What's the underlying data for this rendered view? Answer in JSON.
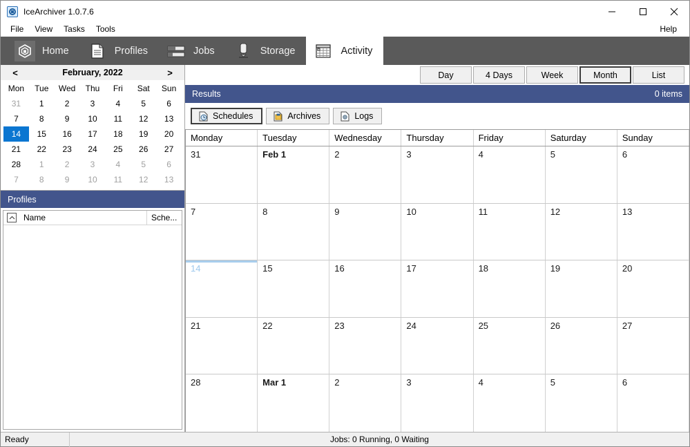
{
  "window": {
    "title": "IceArchiver 1.0.7.6",
    "app_icon": "app-hexagon-icon",
    "minimize_label": "minimize-icon",
    "maximize_label": "maximize-icon",
    "close_label": "close-icon"
  },
  "menubar": {
    "items": [
      "File",
      "View",
      "Tasks",
      "Tools"
    ],
    "help": "Help"
  },
  "ribbon": {
    "tabs": [
      {
        "label": "Home",
        "icon": "hexagon-icon",
        "active": false,
        "selected_box": true
      },
      {
        "label": "Profiles",
        "icon": "document-icon",
        "active": false,
        "selected_box": false
      },
      {
        "label": "Jobs",
        "icon": "bars-icon",
        "active": false,
        "selected_box": false
      },
      {
        "label": "Storage",
        "icon": "tank-icon",
        "active": false,
        "selected_box": false
      },
      {
        "label": "Activity",
        "icon": "calendar-icon",
        "active": true,
        "selected_box": false
      }
    ]
  },
  "mini_calendar": {
    "prev_label": "<",
    "next_label": ">",
    "title": "February, 2022",
    "dow": [
      "Mon",
      "Tue",
      "Wed",
      "Thu",
      "Fri",
      "Sat",
      "Sun"
    ],
    "weeks": [
      [
        {
          "d": "31",
          "type": "other"
        },
        {
          "d": "1",
          "type": "cur"
        },
        {
          "d": "2",
          "type": "cur"
        },
        {
          "d": "3",
          "type": "cur"
        },
        {
          "d": "4",
          "type": "cur"
        },
        {
          "d": "5",
          "type": "cur"
        },
        {
          "d": "6",
          "type": "cur"
        }
      ],
      [
        {
          "d": "7",
          "type": "cur"
        },
        {
          "d": "8",
          "type": "cur"
        },
        {
          "d": "9",
          "type": "cur"
        },
        {
          "d": "10",
          "type": "cur"
        },
        {
          "d": "11",
          "type": "cur"
        },
        {
          "d": "12",
          "type": "cur"
        },
        {
          "d": "13",
          "type": "cur"
        }
      ],
      [
        {
          "d": "14",
          "type": "sel"
        },
        {
          "d": "15",
          "type": "cur"
        },
        {
          "d": "16",
          "type": "cur"
        },
        {
          "d": "17",
          "type": "cur"
        },
        {
          "d": "18",
          "type": "cur"
        },
        {
          "d": "19",
          "type": "cur"
        },
        {
          "d": "20",
          "type": "cur"
        }
      ],
      [
        {
          "d": "21",
          "type": "cur"
        },
        {
          "d": "22",
          "type": "cur"
        },
        {
          "d": "23",
          "type": "cur"
        },
        {
          "d": "24",
          "type": "cur"
        },
        {
          "d": "25",
          "type": "cur"
        },
        {
          "d": "26",
          "type": "cur"
        },
        {
          "d": "27",
          "type": "cur"
        }
      ],
      [
        {
          "d": "28",
          "type": "cur"
        },
        {
          "d": "1",
          "type": "other"
        },
        {
          "d": "2",
          "type": "other"
        },
        {
          "d": "3",
          "type": "other"
        },
        {
          "d": "4",
          "type": "other"
        },
        {
          "d": "5",
          "type": "other"
        },
        {
          "d": "6",
          "type": "other"
        }
      ],
      [
        {
          "d": "7",
          "type": "other"
        },
        {
          "d": "8",
          "type": "other"
        },
        {
          "d": "9",
          "type": "other"
        },
        {
          "d": "10",
          "type": "other"
        },
        {
          "d": "11",
          "type": "other"
        },
        {
          "d": "12",
          "type": "other"
        },
        {
          "d": "13",
          "type": "other"
        }
      ]
    ]
  },
  "profiles_panel": {
    "header": "Profiles",
    "sort_icon": "sort-ascending-icon",
    "columns": [
      "Name",
      "Sche..."
    ],
    "rows": []
  },
  "view_buttons": [
    {
      "label": "Day",
      "selected": false
    },
    {
      "label": "4 Days",
      "selected": false
    },
    {
      "label": "Week",
      "selected": false
    },
    {
      "label": "Month",
      "selected": true
    },
    {
      "label": "List",
      "selected": false
    }
  ],
  "results": {
    "title": "Results",
    "count": "0 items"
  },
  "subtabs": [
    {
      "label": "Schedules",
      "icon": "schedule-clock-icon",
      "selected": true
    },
    {
      "label": "Archives",
      "icon": "archive-box-icon",
      "selected": false
    },
    {
      "label": "Logs",
      "icon": "log-gear-icon",
      "selected": false
    }
  ],
  "calendar": {
    "day_headers": [
      "Monday",
      "Tuesday",
      "Wednesday",
      "Thursday",
      "Friday",
      "Saturday",
      "Sunday"
    ],
    "weeks": [
      [
        {
          "label": "31",
          "bold": false,
          "today": false
        },
        {
          "label": "Feb 1",
          "bold": true,
          "today": false
        },
        {
          "label": "2",
          "bold": false,
          "today": false
        },
        {
          "label": "3",
          "bold": false,
          "today": false
        },
        {
          "label": "4",
          "bold": false,
          "today": false
        },
        {
          "label": "5",
          "bold": false,
          "today": false
        },
        {
          "label": "6",
          "bold": false,
          "today": false
        }
      ],
      [
        {
          "label": "7",
          "bold": false,
          "today": false
        },
        {
          "label": "8",
          "bold": false,
          "today": false
        },
        {
          "label": "9",
          "bold": false,
          "today": false
        },
        {
          "label": "10",
          "bold": false,
          "today": false
        },
        {
          "label": "11",
          "bold": false,
          "today": false
        },
        {
          "label": "12",
          "bold": false,
          "today": false
        },
        {
          "label": "13",
          "bold": false,
          "today": false
        }
      ],
      [
        {
          "label": "14",
          "bold": false,
          "today": true
        },
        {
          "label": "15",
          "bold": false,
          "today": false
        },
        {
          "label": "16",
          "bold": false,
          "today": false
        },
        {
          "label": "17",
          "bold": false,
          "today": false
        },
        {
          "label": "18",
          "bold": false,
          "today": false
        },
        {
          "label": "19",
          "bold": false,
          "today": false
        },
        {
          "label": "20",
          "bold": false,
          "today": false
        }
      ],
      [
        {
          "label": "21",
          "bold": false,
          "today": false
        },
        {
          "label": "22",
          "bold": false,
          "today": false
        },
        {
          "label": "23",
          "bold": false,
          "today": false
        },
        {
          "label": "24",
          "bold": false,
          "today": false
        },
        {
          "label": "25",
          "bold": false,
          "today": false
        },
        {
          "label": "26",
          "bold": false,
          "today": false
        },
        {
          "label": "27",
          "bold": false,
          "today": false
        }
      ],
      [
        {
          "label": "28",
          "bold": false,
          "today": false
        },
        {
          "label": "Mar 1",
          "bold": true,
          "today": false
        },
        {
          "label": "2",
          "bold": false,
          "today": false
        },
        {
          "label": "3",
          "bold": false,
          "today": false
        },
        {
          "label": "4",
          "bold": false,
          "today": false
        },
        {
          "label": "5",
          "bold": false,
          "today": false
        },
        {
          "label": "6",
          "bold": false,
          "today": false
        }
      ]
    ]
  },
  "statusbar": {
    "left": "Ready",
    "jobs": "Jobs: 0 Running, 0 Waiting"
  },
  "colors": {
    "panel_header": "#42558c",
    "ribbon": "#5a5a5a",
    "selection_blue": "#0b76d1",
    "today_blue": "#a8cdec"
  }
}
